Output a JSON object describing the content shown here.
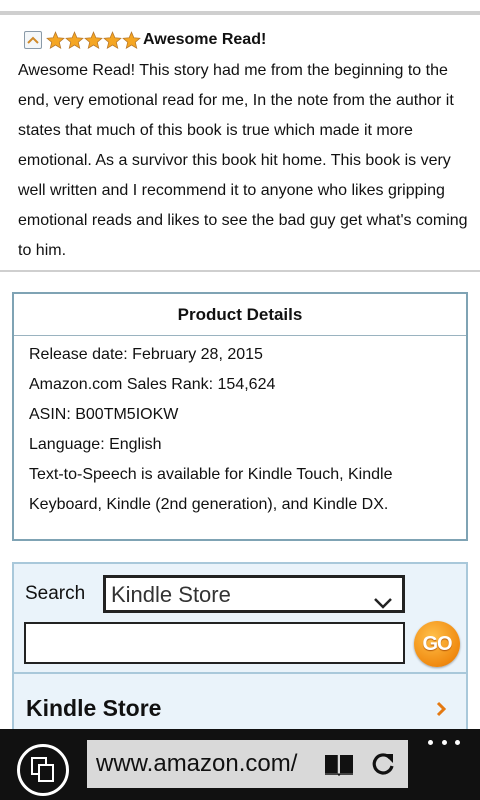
{
  "review": {
    "rating": 5,
    "max_rating": 5,
    "title": "Awesome Read!",
    "body": "Awesome Read! This story had me from the beginning to the end, very emotional read for me, In the note from the author it states that much of this book is true which made it more emotional. As a survivor this book hit home. This book is very well written and I recommend it to anyone who likes gripping emotional reads and likes to see the bad guy get what's coming to him."
  },
  "product_details": {
    "title": "Product Details",
    "items": [
      "Release date: February 28, 2015",
      "Amazon.com Sales Rank: 154,624",
      "ASIN: B00TM5IOKW",
      "Language: English",
      "Text-to-Speech is available for Kindle Touch, Kindle Keyboard, Kindle (2nd generation), and Kindle DX."
    ]
  },
  "search": {
    "label": "Search",
    "department": "Kindle Store",
    "query": "",
    "go_label": "GO"
  },
  "store_link": {
    "label": "Kindle Store"
  },
  "browser": {
    "address": "www.amazon.com/"
  },
  "colors": {
    "star": "#f5a623",
    "go_button": "#f08a10",
    "panel_border": "#7fa3b4",
    "search_bg": "#eaf3fa",
    "arrow": "#e47911"
  }
}
